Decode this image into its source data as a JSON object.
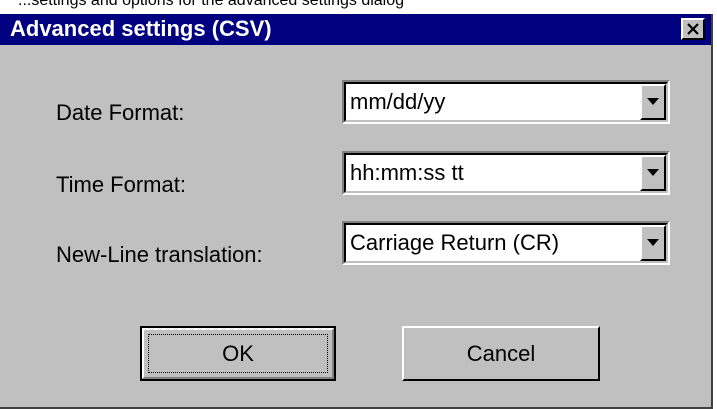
{
  "caption_fragment": "...settings and options for the advanced settings dialog",
  "dialog": {
    "title": "Advanced settings (CSV)",
    "close_icon": "close-icon"
  },
  "fields": [
    {
      "label": "Date Format:",
      "value": "mm/dd/yy"
    },
    {
      "label": "Time Format:",
      "value": "hh:mm:ss tt"
    },
    {
      "label": "New-Line translation:",
      "value": "Carriage Return (CR)"
    }
  ],
  "buttons": {
    "ok_label": "OK",
    "cancel_label": "Cancel"
  },
  "colors": {
    "title_bar": "#000080",
    "dialog_face": "#c0c0c0"
  }
}
